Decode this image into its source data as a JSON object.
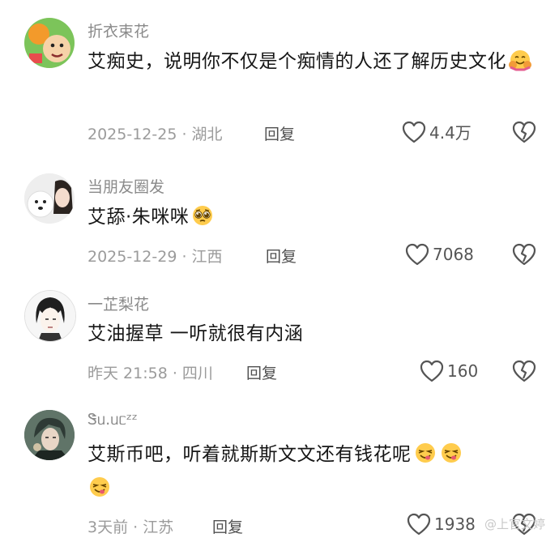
{
  "comments": [
    {
      "username": "折衣束花",
      "text": "艾痴史，说明你不仅是个痴情的人还了解历史文化",
      "meta": "2025-12-25 · 湖北",
      "reply_label": "回复",
      "likes": "4.4万",
      "emoji": "hug-face"
    },
    {
      "username": "当朋友圈发",
      "text": "艾舔·朱咪咪",
      "meta": "2025-12-29 · 江西",
      "reply_label": "回复",
      "likes": "7068",
      "emoji": "pleading-face"
    },
    {
      "username": "一芷梨花",
      "text": "艾油握草  一听就很有内涵",
      "meta": "昨天 21:58 · 四川",
      "reply_label": "回复",
      "likes": "160"
    },
    {
      "username": "Ꮥᥙ.ᥙᥴᶻᶻ",
      "text": "艾斯币吧，听着就斯斯文文还有钱花呢",
      "meta": "3天前 · 江苏",
      "reply_label": "回复",
      "likes": "1938",
      "emoji": "yum-face"
    }
  ],
  "watermark": "@上官文婷",
  "colors": {
    "text": "#161616",
    "username": "#8a8a8a",
    "meta": "#9b9b9b",
    "icon": "#555555"
  }
}
